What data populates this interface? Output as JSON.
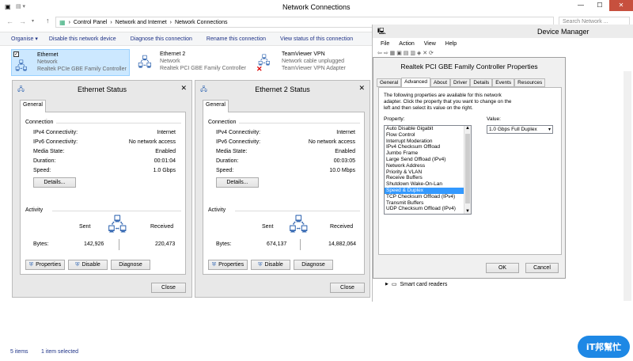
{
  "net_conn": {
    "title": "Network Connections",
    "window_controls": [
      "—",
      "☐",
      "✕"
    ],
    "breadcrumb": [
      "Control Panel",
      "Network and Internet",
      "Network Connections"
    ],
    "search_placeholder": "Search Network ...",
    "toolbar": [
      "Organise",
      "Disable this network device",
      "Diagnose this connection",
      "Rename this connection",
      "View status of this connection"
    ],
    "adapters": [
      {
        "name": "Ethernet",
        "line2": "Network",
        "line3": "Realtek PCIe GBE Family Controller"
      },
      {
        "name": "Ethernet 2",
        "line2": "Network",
        "line3": "Realtek PCI GBE Family Controller"
      },
      {
        "name": "TeamViewer VPN",
        "line2": "Network cable unplugged",
        "line3": "TeamViewer VPN Adapter"
      }
    ],
    "status_left": "5 items",
    "status_sel": "1 item selected"
  },
  "status1": {
    "title": "Ethernet Status",
    "tab": "General",
    "connection_label": "Connection",
    "rows": [
      {
        "label": "IPv4 Connectivity:",
        "value": "Internet"
      },
      {
        "label": "IPv6 Connectivity:",
        "value": "No network access"
      },
      {
        "label": "Media State:",
        "value": "Enabled"
      },
      {
        "label": "Duration:",
        "value": "00:01:04"
      },
      {
        "label": "Speed:",
        "value": "1.0 Gbps"
      }
    ],
    "details": "Details...",
    "activity_label": "Activity",
    "sent": "Sent",
    "received": "Received",
    "bytes_label": "Bytes:",
    "bytes_sent": "142,926",
    "bytes_received": "220,473",
    "properties": "Properties",
    "disable": "Disable",
    "diagnose": "Diagnose",
    "close": "Close"
  },
  "status2": {
    "title": "Ethernet 2 Status",
    "tab": "General",
    "connection_label": "Connection",
    "rows": [
      {
        "label": "IPv4 Connectivity:",
        "value": "Internet"
      },
      {
        "label": "IPv6 Connectivity:",
        "value": "No network access"
      },
      {
        "label": "Media State:",
        "value": "Enabled"
      },
      {
        "label": "Duration:",
        "value": "00:03:05"
      },
      {
        "label": "Speed:",
        "value": "10.0 Mbps"
      }
    ],
    "details": "Details...",
    "activity_label": "Activity",
    "sent": "Sent",
    "received": "Received",
    "bytes_label": "Bytes:",
    "bytes_sent": "674,137",
    "bytes_received": "14,882,064",
    "properties": "Properties",
    "disable": "Disable",
    "diagnose": "Diagnose",
    "close": "Close"
  },
  "devmgr": {
    "title": "Device Manager",
    "menu": [
      "File",
      "Action",
      "View",
      "Help"
    ],
    "tree_item": "Smart card readers"
  },
  "props": {
    "title": "Realtek PCI GBE Family Controller Properties",
    "tabs": [
      "General",
      "Advanced",
      "About",
      "Driver",
      "Details",
      "Events",
      "Resources"
    ],
    "description": "The following properties are available for this network adapter. Click the property that you want to change on the left and then select its value on the right.",
    "property_label": "Property:",
    "value_label": "Value:",
    "value_selected": "1.0 Gbps Full Duplex",
    "properties": [
      "Auto Disable Gigabit",
      "Flow Control",
      "Interrupt Moderation",
      "IPv4 Checksum Offload",
      "Jumbo Frame",
      "Large Send Offload (IPv4)",
      "Network Address",
      "Priority & VLAN",
      "Receive Buffers",
      "Shutdown Wake-On-Lan",
      "Speed & Duplex",
      "TCP Checksum Offload (IPv4)",
      "Transmit Buffers",
      "UDP Checksum Offload (IPv4)"
    ],
    "selected_index": 10,
    "ok": "OK",
    "cancel": "Cancel"
  },
  "watermark": "iT邦幫忙",
  "colors": {
    "accent": "#3399ff",
    "toolbar_bg": "#f5f6f7",
    "dialog_bg": "#f0f0f0"
  }
}
